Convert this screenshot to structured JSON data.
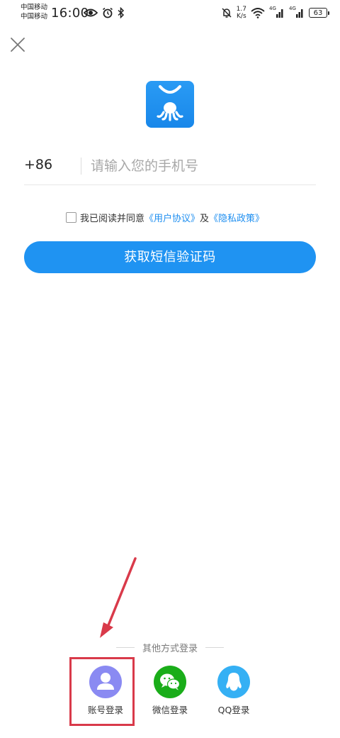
{
  "status_bar": {
    "carrier_1": "中国移动",
    "carrier_2": "中国移动",
    "time": "16:00",
    "net_speed_value": "1.7",
    "net_speed_unit": "K/s",
    "network_label_1": "4G",
    "network_label_2": "4G",
    "battery": "63"
  },
  "login": {
    "country_code": "+86",
    "phone_placeholder": "请输入您的手机号",
    "agree_prefix": "我已阅读并同意",
    "user_agreement": "《用户协议》",
    "and_text": "及",
    "privacy_policy": "《隐私政策》",
    "sms_button": "获取短信验证码"
  },
  "other_login": {
    "title": "其他方式登录",
    "options": [
      {
        "label": "账号登录",
        "icon": "user-icon",
        "color": "#8a8af2"
      },
      {
        "label": "微信登录",
        "icon": "wechat-icon",
        "color": "#1aad19"
      },
      {
        "label": "QQ登录",
        "icon": "qq-icon",
        "color": "#35b0f4"
      }
    ]
  },
  "colors": {
    "primary": "#1f93f2",
    "link": "#1d8ef0",
    "annotation": "#d93a4a"
  }
}
